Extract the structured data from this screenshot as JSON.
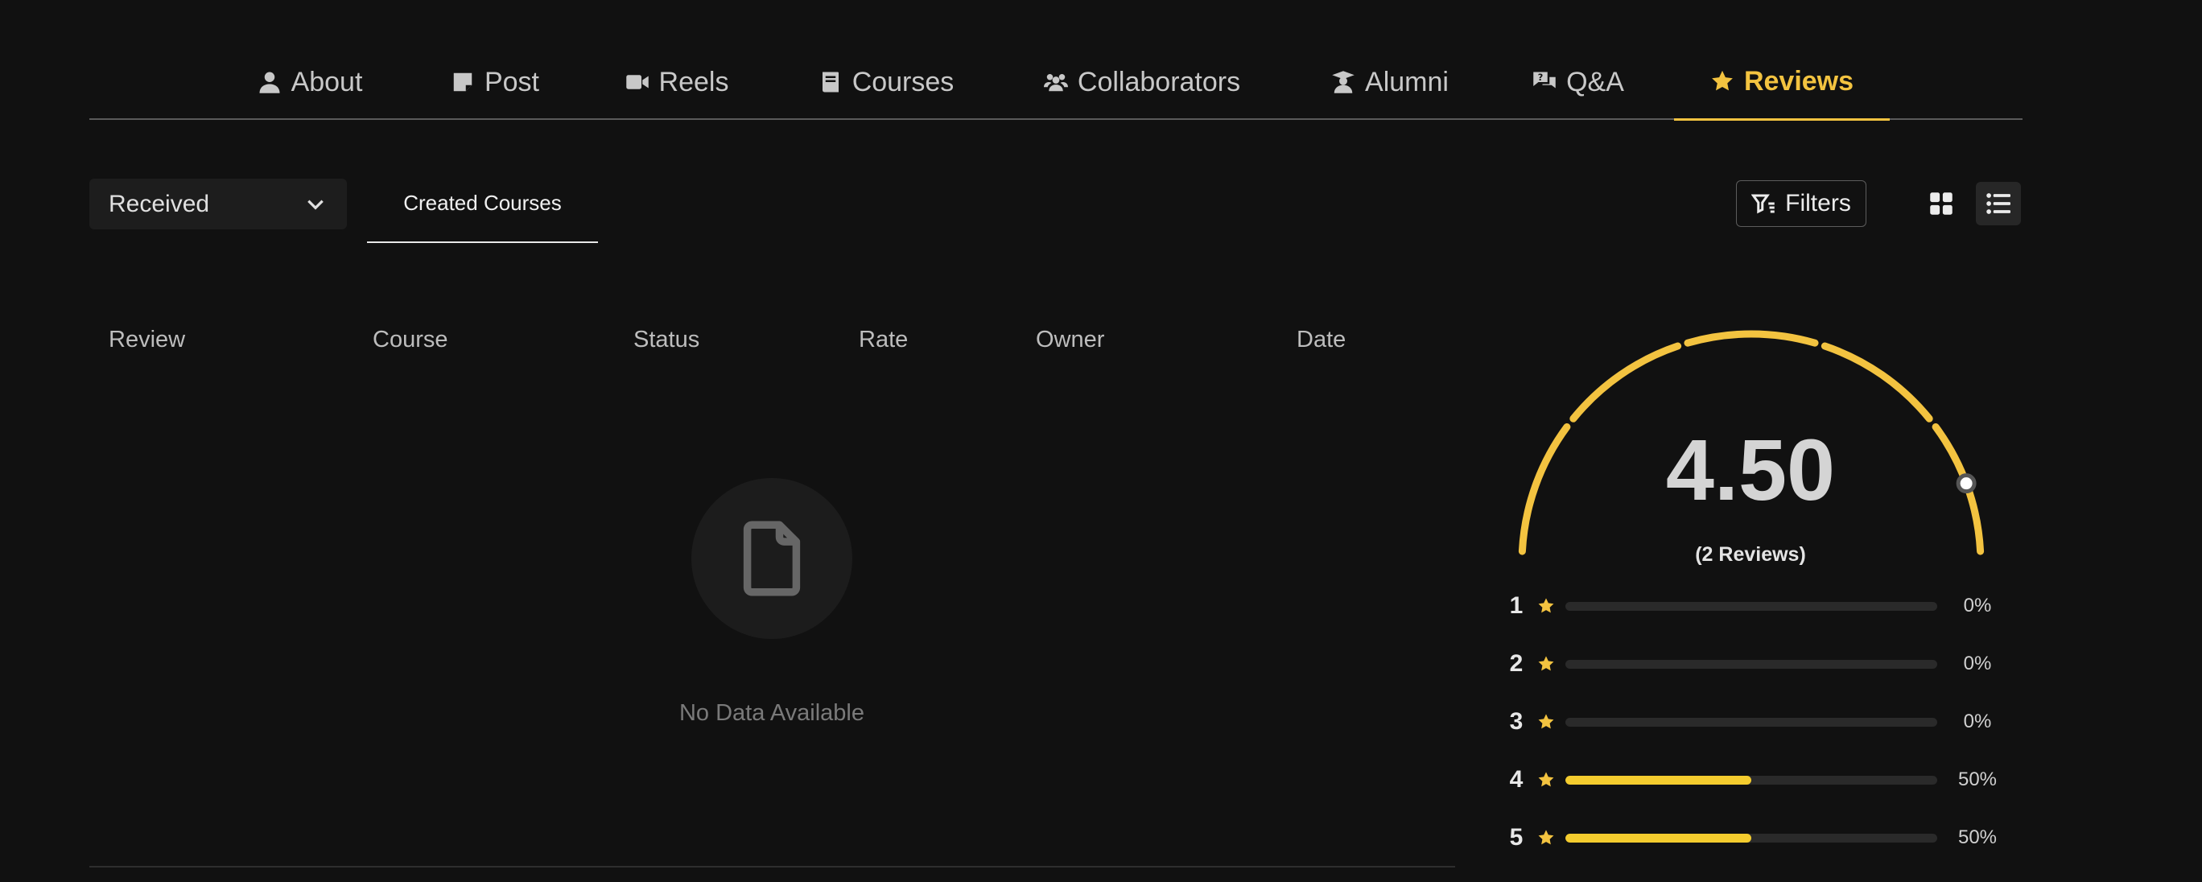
{
  "nav": {
    "tabs": [
      {
        "label": "About",
        "icon": "user-icon"
      },
      {
        "label": "Post",
        "icon": "note-icon"
      },
      {
        "label": "Reels",
        "icon": "video-icon"
      },
      {
        "label": "Courses",
        "icon": "book-icon"
      },
      {
        "label": "Collaborators",
        "icon": "users-icon"
      },
      {
        "label": "Alumni",
        "icon": "graduate-icon"
      },
      {
        "label": "Q&A",
        "icon": "comments-icon"
      },
      {
        "label": "Reviews",
        "icon": "star-icon"
      }
    ],
    "active": "Reviews"
  },
  "toolbar": {
    "dropdown_value": "Received",
    "sub_tab_label": "Created Courses",
    "filters_label": "Filters",
    "view_mode": "list"
  },
  "table": {
    "columns": [
      "Review",
      "Course",
      "Status",
      "Rate",
      "Owner",
      "Date"
    ],
    "empty_message": "No Data Available"
  },
  "rating": {
    "score": "4.50",
    "review_count_label": "(2 Reviews)",
    "gauge_fraction": 0.9,
    "breakdown": [
      {
        "stars": "1",
        "percent": 0,
        "label": "0%"
      },
      {
        "stars": "2",
        "percent": 0,
        "label": "0%"
      },
      {
        "stars": "3",
        "percent": 0,
        "label": "0%"
      },
      {
        "stars": "4",
        "percent": 50,
        "label": "50%"
      },
      {
        "stars": "5",
        "percent": 50,
        "label": "50%"
      }
    ]
  },
  "colors": {
    "accent": "#f3c340",
    "background": "#111111",
    "bar_fill": "#f4cc2e",
    "bar_track": "#2a2a2a"
  }
}
